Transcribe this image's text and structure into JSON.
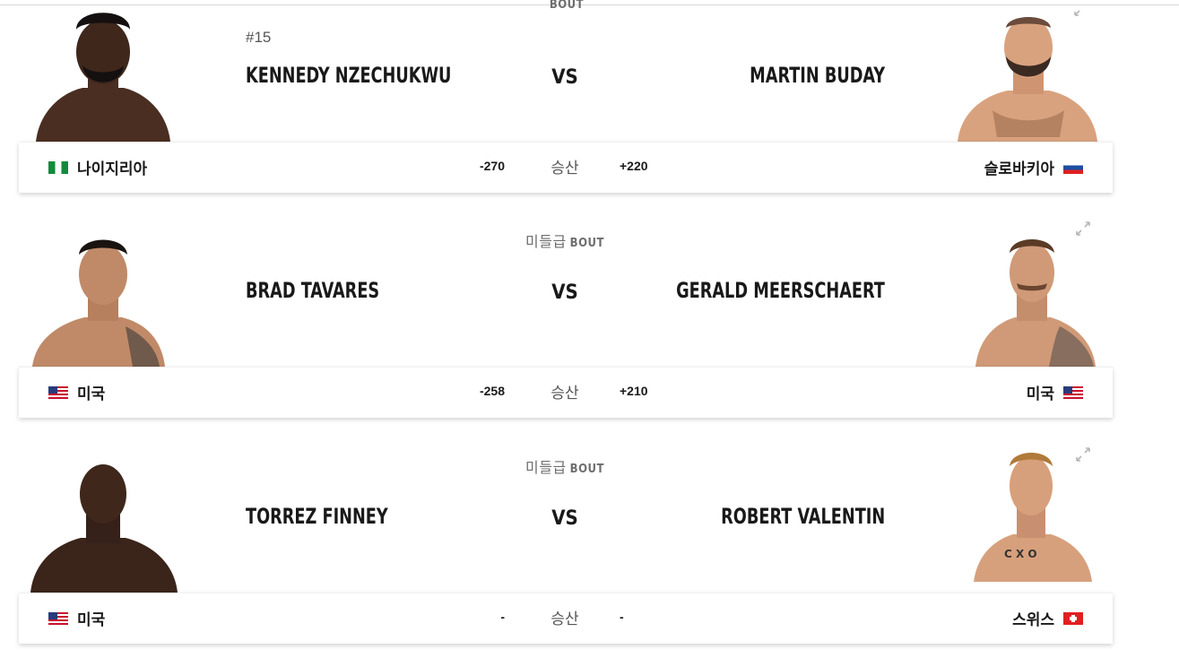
{
  "bouts": [
    {
      "weight_class": "",
      "bout_label": "BOUT",
      "rank": "#15",
      "red_name": "KENNEDY NZECHUKWU",
      "vs": "VS",
      "blue_name": "MARTIN BUDAY",
      "red_country": "나이지리아",
      "blue_country": "슬로바키아",
      "red_odds": "-270",
      "odds_label": "승산",
      "blue_odds": "+220",
      "red_flag": "nigeria-flag",
      "blue_flag": "slovakia-flag"
    },
    {
      "weight_class": "미들급",
      "bout_label": "BOUT",
      "rank": "",
      "red_name": "BRAD TAVARES",
      "vs": "VS",
      "blue_name": "GERALD MEERSCHAERT",
      "red_country": "미국",
      "blue_country": "미국",
      "red_odds": "-258",
      "odds_label": "승산",
      "blue_odds": "+210",
      "red_flag": "usa-flag",
      "blue_flag": "usa-flag"
    },
    {
      "weight_class": "미들급",
      "bout_label": "BOUT",
      "rank": "",
      "red_name": "TORREZ FINNEY",
      "vs": "VS",
      "blue_name": "ROBERT VALENTIN",
      "red_country": "미국",
      "blue_country": "스위스",
      "red_odds": "-",
      "odds_label": "승산",
      "blue_odds": "-",
      "red_flag": "usa-flag",
      "blue_flag": "switzerland-flag"
    }
  ],
  "colors": {
    "text": "#191919",
    "muted": "#6e6e6e",
    "skin_dark": "#4a2e22",
    "skin_light": "#d9a27e"
  }
}
